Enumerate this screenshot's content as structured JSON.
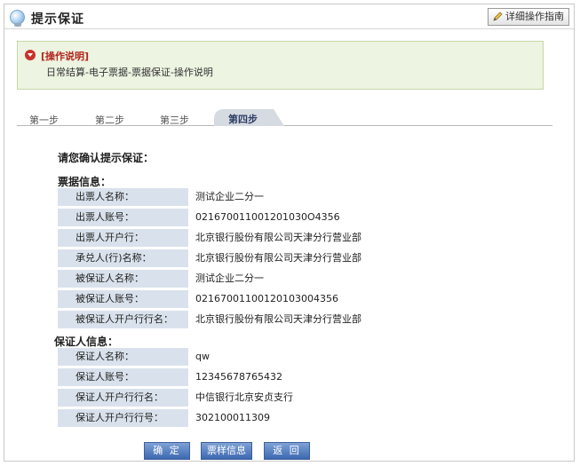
{
  "header": {
    "title": "提示保证",
    "guide_button": "详细操作指南"
  },
  "notice": {
    "title": "[操作说明]",
    "text": "日常结算-电子票据-票据保证-操作说明"
  },
  "tabs": [
    "第一步",
    "第二步",
    "第三步",
    "第四步"
  ],
  "active_tab": "第四步",
  "prompt": "请您确认提示保证：",
  "bill_info": {
    "title": "票据信息：",
    "rows": [
      {
        "label": "出票人名称：",
        "value": "测试企业二分一"
      },
      {
        "label": "出票人账号：",
        "value": "021670011001201030O4356"
      },
      {
        "label": "出票人开户行：",
        "value": "北京银行股份有限公司天津分行营业部"
      },
      {
        "label": "承兑人(行)名称：",
        "value": "北京银行股份有限公司天津分行营业部"
      },
      {
        "label": "被保证人名称：",
        "value": "测试企业二分一"
      },
      {
        "label": "被保证人账号：",
        "value": "02167001100120103004356"
      },
      {
        "label": "被保证人开户行行名：",
        "value": "北京银行股份有限公司天津分行营业部"
      }
    ]
  },
  "guarantor_info": {
    "title": "保证人信息：",
    "rows": [
      {
        "label": "保证人名称：",
        "value": "qw"
      },
      {
        "label": "保证人账号：",
        "value": "12345678765432"
      },
      {
        "label": "保证人开户行行名：",
        "value": "中信银行北京安贞支行"
      },
      {
        "label": "保证人开户行行号：",
        "value": "302100011309"
      }
    ]
  },
  "buttons": {
    "confirm": "确 定",
    "bill_info": "票样信息",
    "back": "返 回"
  },
  "colors": {
    "label_bg": "#d9e2ec",
    "notice_bg": "#edf4e1",
    "button": "#3d68b0",
    "accent_red": "#b3261e"
  }
}
